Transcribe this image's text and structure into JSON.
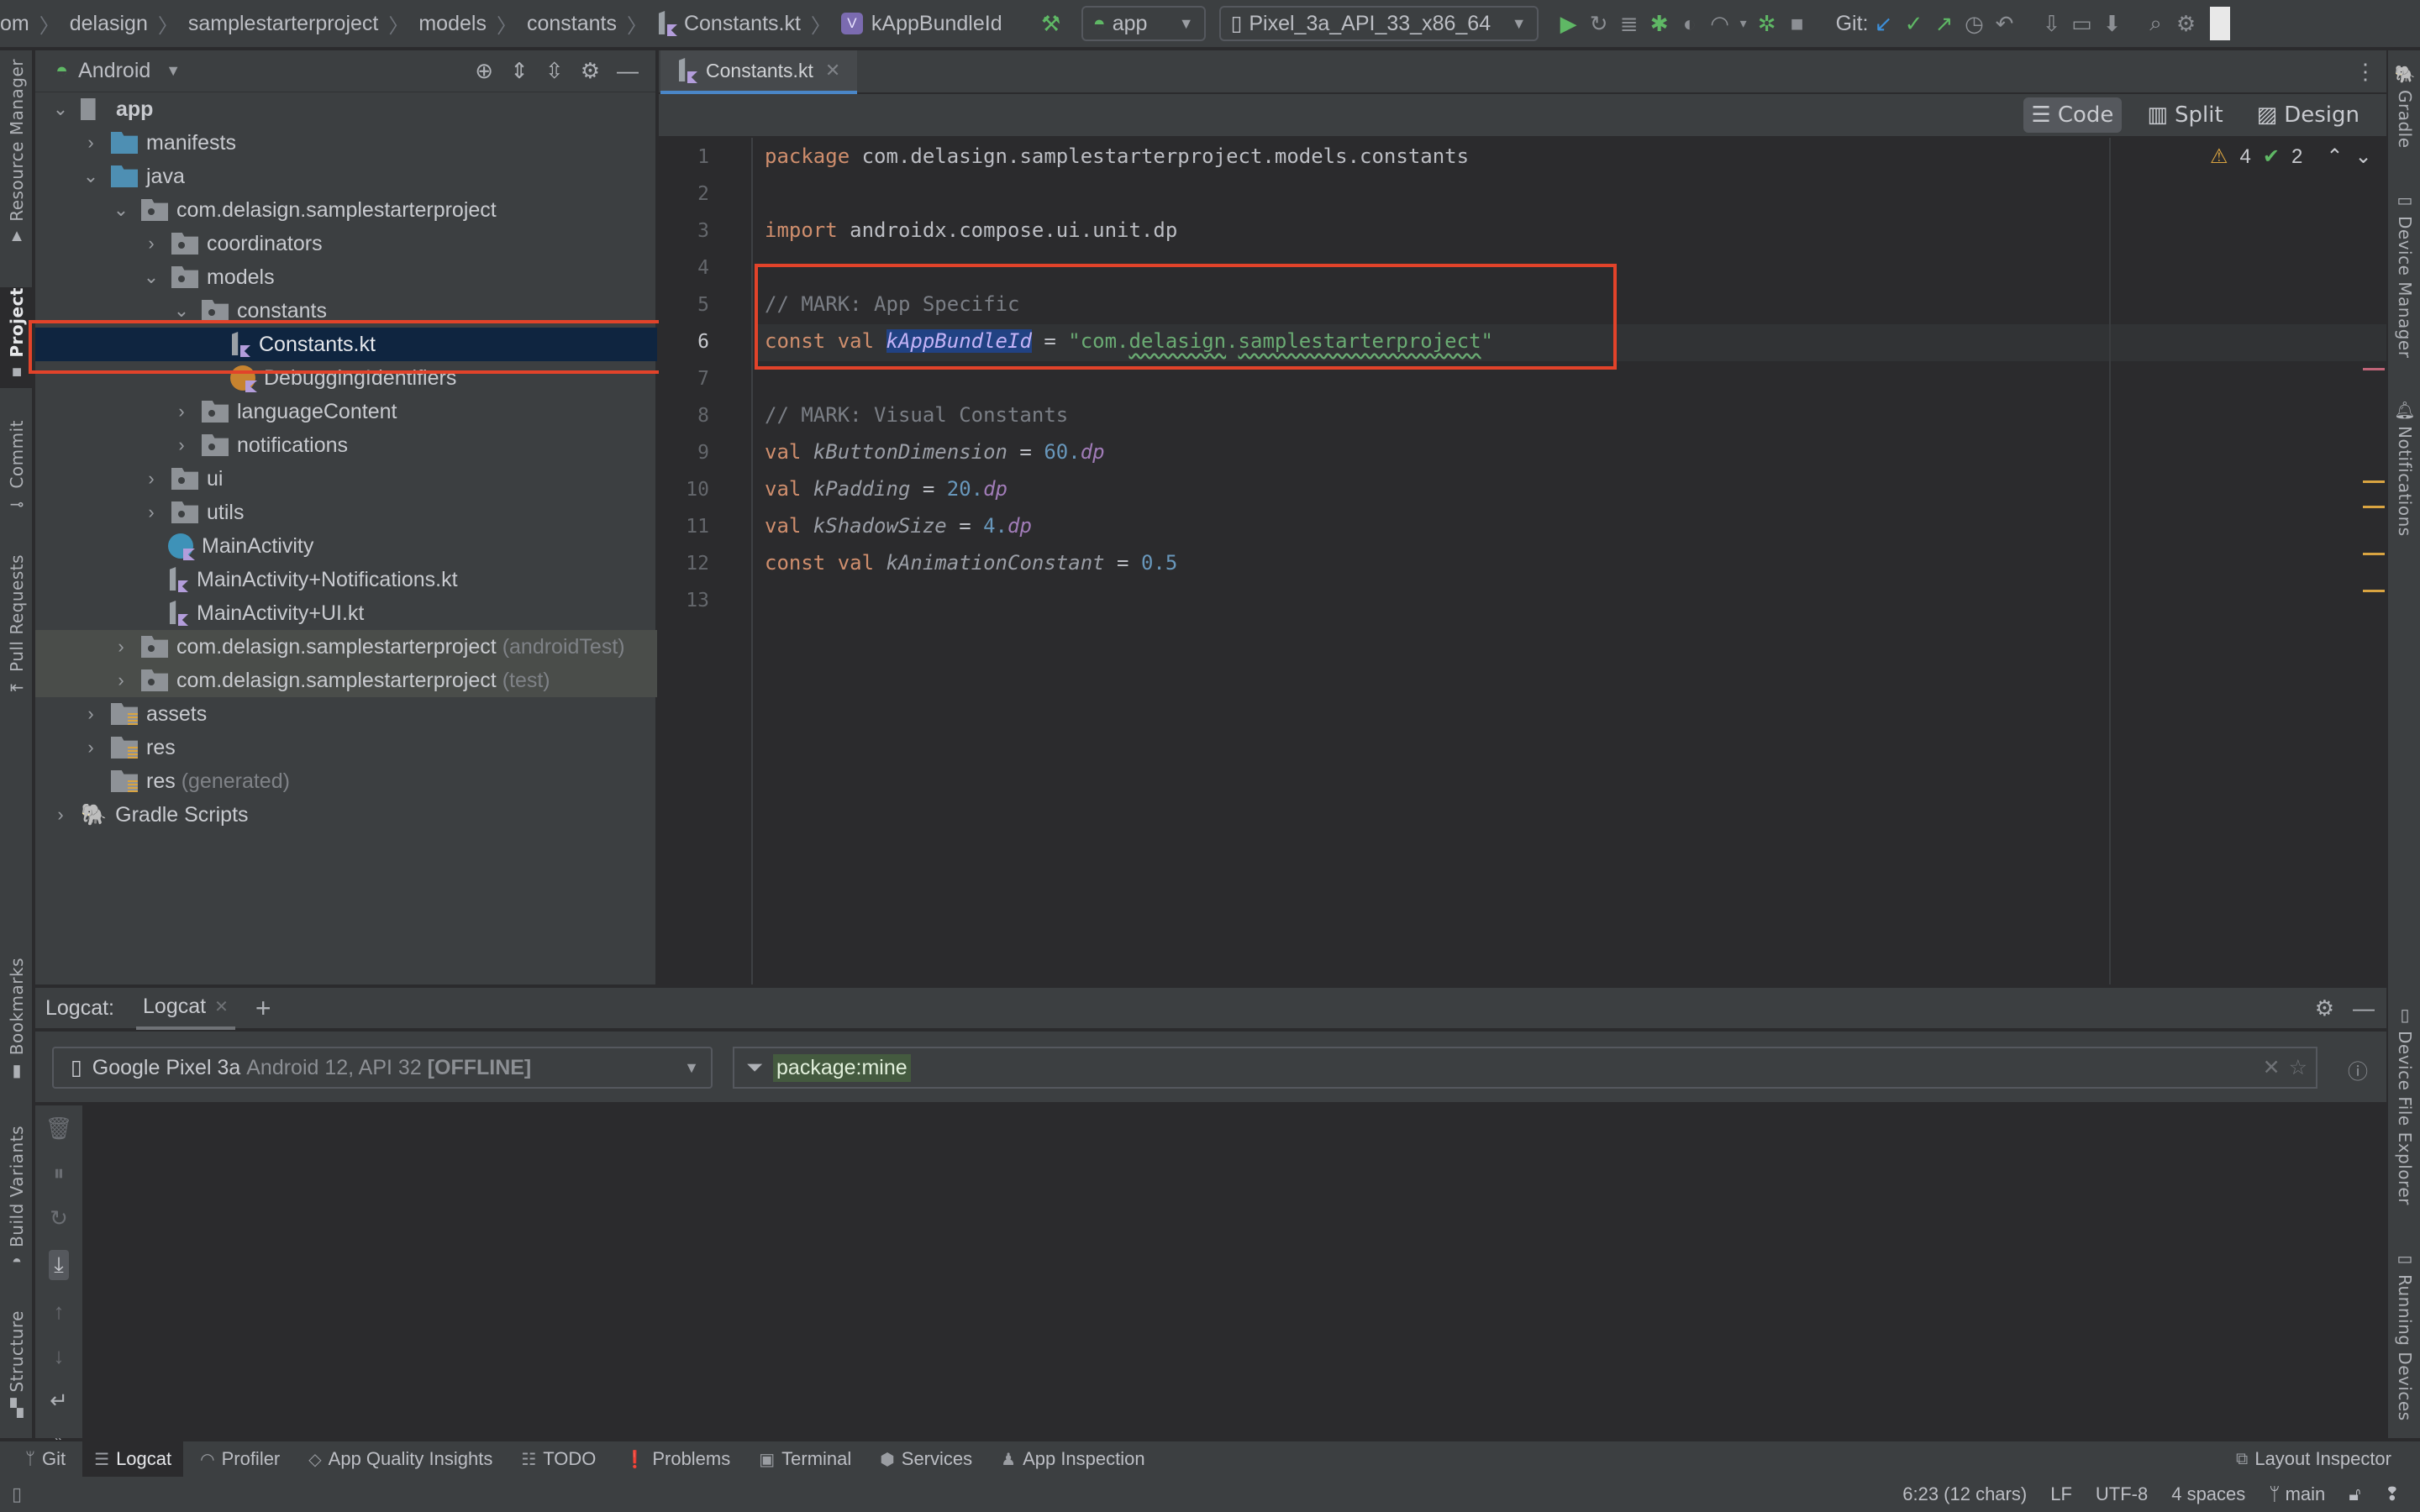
{
  "breadcrumb": {
    "items": [
      "om",
      "delasign",
      "samplestarterproject",
      "models",
      "constants",
      "Constants.kt",
      "kAppBundleId"
    ]
  },
  "toolbar": {
    "run_config": "app",
    "device": "Pixel_3a_API_33_x86_64",
    "git_label": "Git:"
  },
  "left_tools": [
    "Resource Manager",
    "Project",
    "Commit",
    "Pull Requests",
    "Bookmarks",
    "Build Variants",
    "Structure"
  ],
  "right_tools": [
    "Gradle",
    "Device Manager",
    "Notifications",
    "Device File Explorer",
    "Running Devices"
  ],
  "project": {
    "view": "Android",
    "tree": [
      {
        "label": "app",
        "suffix": ""
      },
      {
        "label": "manifests",
        "suffix": ""
      },
      {
        "label": "java",
        "suffix": ""
      },
      {
        "label": "com.delasign.samplestarterproject",
        "suffix": ""
      },
      {
        "label": "coordinators",
        "suffix": ""
      },
      {
        "label": "models",
        "suffix": ""
      },
      {
        "label": "constants",
        "suffix": ""
      },
      {
        "label": "Constants.kt",
        "suffix": ""
      },
      {
        "label": "DebuggingIdentifiers",
        "suffix": ""
      },
      {
        "label": "languageContent",
        "suffix": ""
      },
      {
        "label": "notifications",
        "suffix": ""
      },
      {
        "label": "ui",
        "suffix": ""
      },
      {
        "label": "utils",
        "suffix": ""
      },
      {
        "label": "MainActivity",
        "suffix": ""
      },
      {
        "label": "MainActivity+Notifications.kt",
        "suffix": ""
      },
      {
        "label": "MainActivity+UI.kt",
        "suffix": ""
      },
      {
        "label": "com.delasign.samplestarterproject",
        "suffix": "(androidTest)"
      },
      {
        "label": "com.delasign.samplestarterproject",
        "suffix": "(test)"
      },
      {
        "label": "assets",
        "suffix": ""
      },
      {
        "label": "res",
        "suffix": ""
      },
      {
        "label": "res",
        "suffix": "(generated)"
      },
      {
        "label": "Gradle Scripts",
        "suffix": ""
      }
    ]
  },
  "editor": {
    "tab": "Constants.kt",
    "modes": [
      "Code",
      "Split",
      "Design"
    ],
    "warnings": "4",
    "weak_warnings": "2",
    "line_numbers": [
      "1",
      "2",
      "3",
      "4",
      "5",
      "6",
      "7",
      "8",
      "9",
      "10",
      "11",
      "12",
      "13"
    ],
    "code": {
      "l1_kw": "package",
      "l1_rest": " com.delasign.samplestarterproject.models.constants",
      "l3_kw": "import",
      "l3_rest": " androidx.compose.ui.unit.dp",
      "l5_comment": "// MARK: App Specific",
      "l6_kw": "const val ",
      "l6_id": "kAppBundleId",
      "l6_eq": " = ",
      "l6_q1": "\"com.",
      "l6_s1": "delasign",
      "l6_dot": ".",
      "l6_s2": "samplestarterproject",
      "l6_q2": "\"",
      "l8_comment": "// MARK: Visual Constants",
      "l9_kw": "val ",
      "l9_id": "kButtonDimension",
      "l9_eq": " = ",
      "l9_num": "60.",
      "l9_ext": "dp",
      "l10_kw": "val ",
      "l10_id": "kPadding",
      "l10_eq": " = ",
      "l10_num": "20.",
      "l10_ext": "dp",
      "l11_kw": "val ",
      "l11_id": "kShadowSize",
      "l11_eq": " = ",
      "l11_num": "4.",
      "l11_ext": "dp",
      "l12_kw": "const val ",
      "l12_id": "kAnimationConstant",
      "l12_eq": " = ",
      "l12_num": "0.5"
    }
  },
  "logcat": {
    "label": "Logcat:",
    "tab": "Logcat",
    "device_name": "Google Pixel 3a",
    "device_detail": "Android 12, API 32",
    "device_status": "[OFFLINE]",
    "filter": "package:mine"
  },
  "bottom_tools": [
    "Git",
    "Logcat",
    "Profiler",
    "App Quality Insights",
    "TODO",
    "Problems",
    "Terminal",
    "Services",
    "App Inspection"
  ],
  "layout_inspector": "Layout Inspector",
  "status": {
    "position": "6:23 (12 chars)",
    "line_sep": "LF",
    "encoding": "UTF-8",
    "indent": "4 spaces",
    "branch": "main"
  },
  "colors": {
    "highlight_box": "#e2432a",
    "selection": "#0f2540",
    "keyword": "#cf8e6d",
    "string": "#6aab73",
    "number": "#6897bb"
  }
}
